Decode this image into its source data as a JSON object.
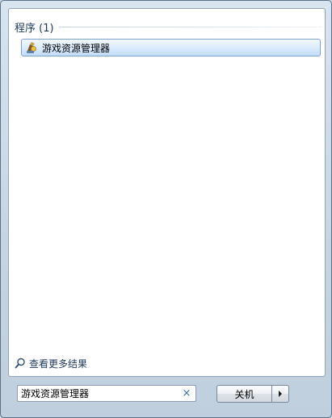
{
  "results": {
    "section_title": "程序 (1)",
    "items": [
      {
        "label": "游戏资源管理器",
        "icon": "game-explorer-icon"
      }
    ]
  },
  "see_more": {
    "label": "查看更多结果",
    "icon": "search-icon"
  },
  "search": {
    "value": "游戏资源管理器",
    "clear_glyph": "×"
  },
  "shutdown": {
    "label": "关机",
    "arrow_icon": "arrow-right-icon"
  },
  "colors": {
    "header_text": "#1e395b",
    "selection_border": "#7da2ce",
    "selection_fill": "#dcebfc",
    "frame": "#c9d6e3"
  }
}
